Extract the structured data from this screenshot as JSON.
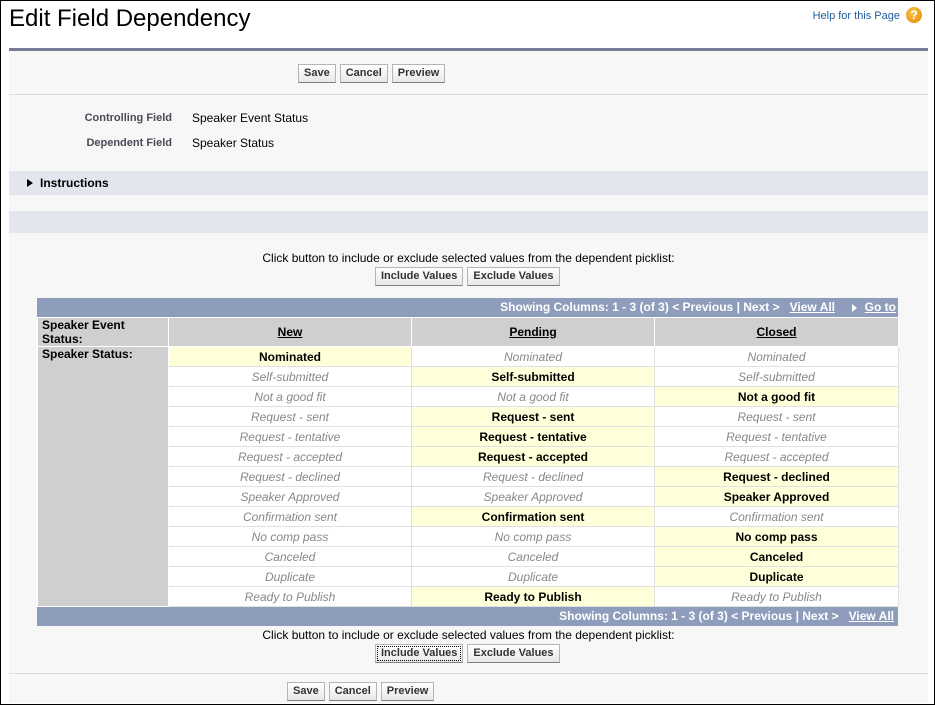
{
  "header": {
    "title": "Edit Field Dependency",
    "help_link": "Help for this Page",
    "help_icon": "question-circle-icon"
  },
  "toolbar": {
    "save_label": "Save",
    "cancel_label": "Cancel",
    "preview_label": "Preview"
  },
  "fields": {
    "controlling_label": "Controlling Field",
    "controlling_value": "Speaker Event Status",
    "dependent_label": "Dependent Field",
    "dependent_value": "Speaker Status"
  },
  "instructions": {
    "label": "Instructions",
    "icon": "triangle-right-icon"
  },
  "actions": {
    "hint": "Click button to include or exclude selected values from the dependent picklist:",
    "include_label": "Include Values",
    "exclude_label": "Exclude Values"
  },
  "grid": {
    "nav": {
      "showing": "Showing Columns: 1 - 3 (of 3)",
      "previous": "< Previous",
      "separator": "|",
      "next": "Next >",
      "view_all": "View All",
      "go_to": "Go to"
    },
    "controlling_row_label": "Speaker Event Status:",
    "dependent_row_label": "Speaker Status:",
    "columns": [
      "New",
      "Pending",
      "Closed"
    ],
    "values": [
      "Nominated",
      "Self-submitted",
      "Not a good fit",
      "Request - sent",
      "Request - tentative",
      "Request - accepted",
      "Request - declined",
      "Speaker Approved",
      "Confirmation sent",
      "No comp pass",
      "Canceled",
      "Duplicate",
      "Ready to Publish"
    ],
    "included": {
      "New": [
        "Nominated"
      ],
      "Pending": [
        "Self-submitted",
        "Request - sent",
        "Request - tentative",
        "Request - accepted",
        "Confirmation sent",
        "Ready to Publish"
      ],
      "Closed": [
        "Not a good fit",
        "Request - declined",
        "Speaker Approved",
        "No comp pass",
        "Canceled",
        "Duplicate"
      ]
    }
  },
  "colors": {
    "included_bg": "#ffffd9",
    "nav_bar": "#8e9dbb",
    "header_bar": "#747e96",
    "section_bar": "#e3e6ef",
    "help_link": "#1f5b9a"
  }
}
